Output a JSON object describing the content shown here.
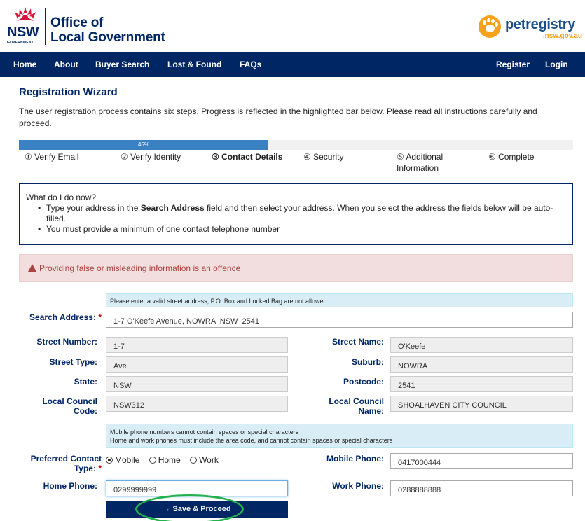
{
  "header": {
    "nsw": "NSW",
    "nsw_gov": "GOVERNMENT",
    "olg_line1": "Office of",
    "olg_line2": "Local Government",
    "pr_name": "petregistry",
    "pr_sub": ".nsw.gov.au"
  },
  "nav": {
    "home": "Home",
    "about": "About",
    "buyer_search": "Buyer Search",
    "lost_found": "Lost & Found",
    "faqs": "FAQs",
    "register": "Register",
    "login": "Login"
  },
  "page": {
    "title": "Registration Wizard",
    "intro": "The user registration process contains six steps. Progress is reflected in the highlighted bar below. Please read all instructions carefully and proceed."
  },
  "progress": {
    "value": 0.45,
    "label": "45%",
    "steps": [
      "① Verify Email",
      "② Verify Identity",
      "③ Contact Details",
      "④ Security",
      "⑤ Additional Information",
      "⑥ Complete"
    ],
    "active_step": 2
  },
  "help": {
    "title": "What do I do now?",
    "item1_pre": "Type your address in the ",
    "item1_bold": "Search Address",
    "item1_post": " field and then select your address. When you select the address the fields below will be auto-filled.",
    "item2": "You must provide a minimum of one contact telephone number"
  },
  "alert": {
    "text": "Providing false or misleading information is an offence"
  },
  "info": {
    "address_note": "Please enter a valid street address, P.O. Box and Locked Bag are not allowed.",
    "phone_note1": "Mobile phone numbers cannot contain spaces or special characters",
    "phone_note2": "Home and work phones must include the area code, and cannot contain spaces or special characters"
  },
  "form": {
    "search_address_label": "Search Address:",
    "search_address": "1-7 O'Keefe Avenue, NOWRA  NSW  2541",
    "street_number_label": "Street Number:",
    "street_number": "1-7",
    "street_name_label": "Street Name:",
    "street_name": "O'Keefe",
    "street_type_label": "Street Type:",
    "street_type": "Ave",
    "suburb_label": "Suburb:",
    "suburb": "NOWRA",
    "state_label": "State:",
    "state": "NSW",
    "postcode_label": "Postcode:",
    "postcode": "2541",
    "council_code_label1": "Local Council",
    "council_code_label2": "Code:",
    "council_code": "NSW312",
    "council_name_label1": "Local Council",
    "council_name_label2": "Name:",
    "council_name": "SHOALHAVEN CITY COUNCIL",
    "pref_contact_label1": "Preferred Contact",
    "pref_contact_label2": "Type:",
    "pref_options": [
      "Mobile",
      "Home",
      "Work"
    ],
    "pref_selected": "Mobile",
    "mobile_label": "Mobile Phone:",
    "mobile": "0417000444",
    "home_label": "Home Phone:",
    "home": "0299999999",
    "work_label": "Work Phone:",
    "work": "0288888888",
    "save_label": "→ Save & Proceed"
  },
  "colors": {
    "navy": "#002664",
    "progress": "#3a81c4",
    "orange": "#f7a21b",
    "highlight_oval": "#22b14c"
  }
}
